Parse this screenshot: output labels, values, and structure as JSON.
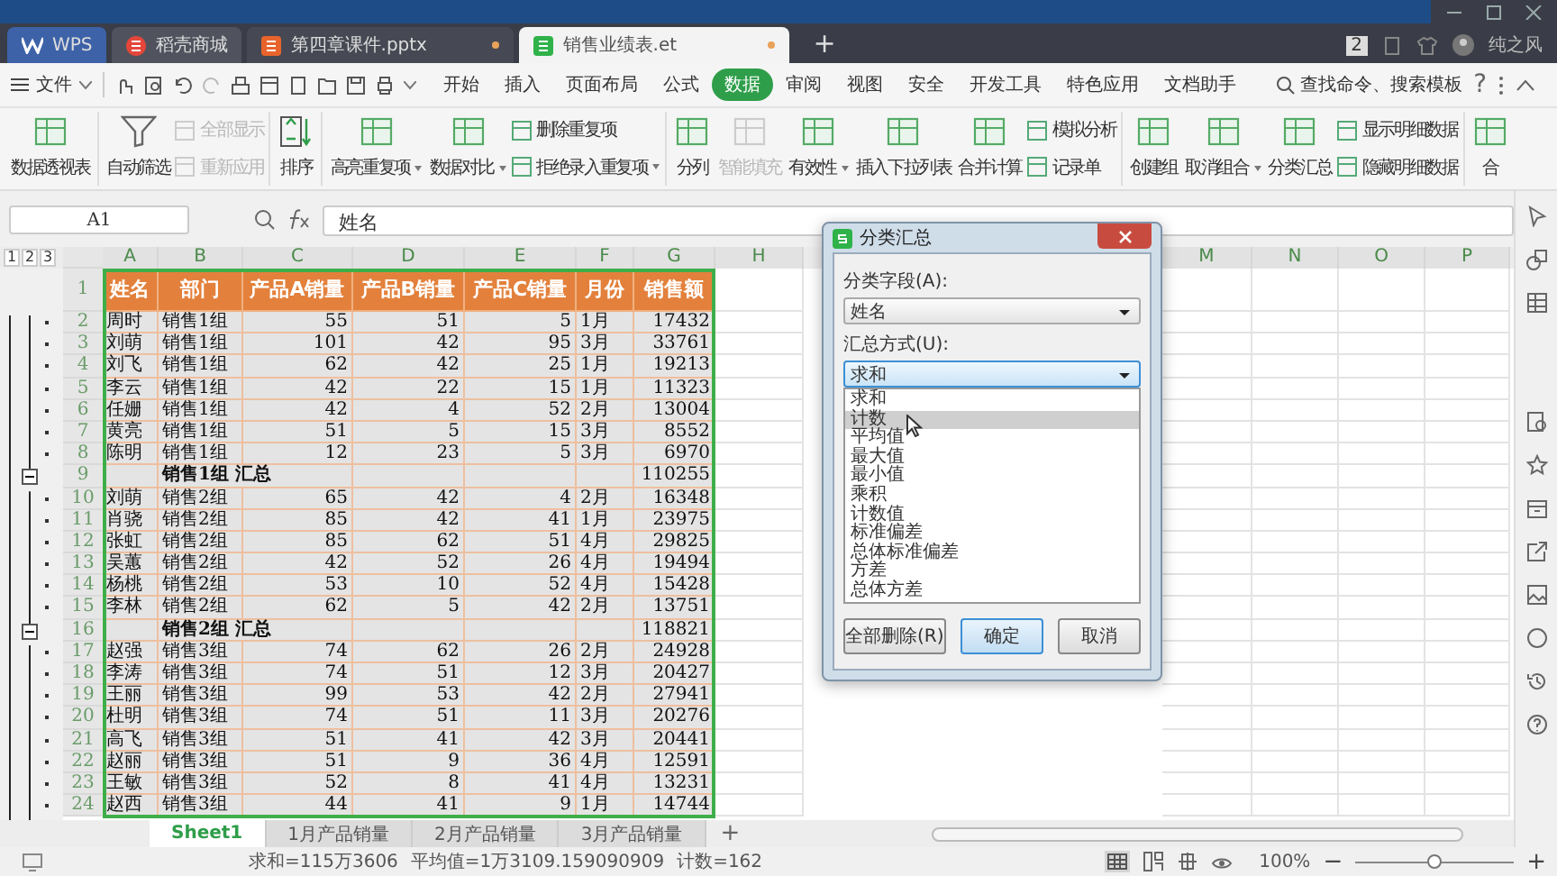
{
  "tabs": [
    {
      "label": "WPS",
      "kind": "home",
      "selected": false
    },
    {
      "label": "稻壳商城",
      "kind": "store",
      "selected": false
    },
    {
      "label": "第四章课件.pptx",
      "kind": "slides",
      "selected": false
    },
    {
      "label": "销售业绩表.et",
      "kind": "sheet",
      "selected": true
    }
  ],
  "new_tab": "+",
  "title_bar": {
    "badge": "2",
    "user": "纯之风"
  },
  "menu": {
    "file": "文件",
    "tabs": [
      {
        "label": "开始",
        "selected": false
      },
      {
        "label": "插入",
        "selected": false
      },
      {
        "label": "页面布局",
        "selected": false
      },
      {
        "label": "公式",
        "selected": false
      },
      {
        "label": "数据",
        "selected": true
      },
      {
        "label": "审阅",
        "selected": false
      },
      {
        "label": "视图",
        "selected": false
      },
      {
        "label": "安全",
        "selected": false
      },
      {
        "label": "开发工具",
        "selected": false
      },
      {
        "label": "特色应用",
        "selected": false
      },
      {
        "label": "文档助手",
        "selected": false
      }
    ],
    "search": "查找命令、搜索模板",
    "help": "?"
  },
  "ribbon": [
    {
      "items": [
        {
          "kind": "large",
          "label": "数据透视表",
          "dropdown": false,
          "disabled": false
        }
      ]
    },
    {
      "items": [
        {
          "kind": "large",
          "label": "自动筛选",
          "dropdown": false,
          "disabled": false
        },
        {
          "kind": "pair",
          "items": [
            {
              "label": "全部显示",
              "dropdown": false,
              "disabled": true
            },
            {
              "label": "重新应用",
              "dropdown": false,
              "disabled": true
            }
          ]
        }
      ]
    },
    {
      "items": [
        {
          "kind": "large",
          "label": "排序",
          "dropdown": false,
          "disabled": false
        }
      ]
    },
    {
      "items": [
        {
          "kind": "large",
          "label": "高亮重复项",
          "dropdown": true,
          "disabled": false
        },
        {
          "kind": "large",
          "label": "数据对比",
          "dropdown": true,
          "disabled": false
        },
        {
          "kind": "pair",
          "items": [
            {
              "label": "删除重复项",
              "dropdown": false,
              "disabled": false
            },
            {
              "label": "拒绝录入重复项",
              "dropdown": true,
              "disabled": false
            }
          ]
        }
      ]
    },
    {
      "items": [
        {
          "kind": "large",
          "label": "分列",
          "dropdown": false,
          "disabled": false
        },
        {
          "kind": "large",
          "label": "智能填充",
          "dropdown": false,
          "disabled": true
        },
        {
          "kind": "large",
          "label": "有效性",
          "dropdown": true,
          "disabled": false
        },
        {
          "kind": "large",
          "label": "插入下拉列表",
          "dropdown": false,
          "disabled": false
        },
        {
          "kind": "large",
          "label": "合并计算",
          "dropdown": false,
          "disabled": false
        },
        {
          "kind": "pair",
          "items": [
            {
              "label": "模拟分析",
              "dropdown": false,
              "disabled": false
            },
            {
              "label": "记录单",
              "dropdown": false,
              "disabled": false
            }
          ]
        }
      ]
    },
    {
      "items": [
        {
          "kind": "large",
          "label": "创建组",
          "dropdown": false,
          "disabled": false
        },
        {
          "kind": "large",
          "label": "取消组合",
          "dropdown": true,
          "disabled": false
        },
        {
          "kind": "large",
          "label": "分类汇总",
          "dropdown": false,
          "disabled": false
        },
        {
          "kind": "pair",
          "items": [
            {
              "label": "显示明细数据",
              "dropdown": false,
              "disabled": false
            },
            {
              "label": "隐藏明细数据",
              "dropdown": false,
              "disabled": false
            }
          ]
        }
      ]
    },
    {
      "items": [
        {
          "kind": "large",
          "label": "合",
          "dropdown": false,
          "disabled": false
        }
      ]
    }
  ],
  "formula_bar": {
    "name_box": "A1",
    "formula": "姓名"
  },
  "outline_levels": [
    "1",
    "2",
    "3"
  ],
  "columns": [
    "A",
    "B",
    "C",
    "D",
    "E",
    "F",
    "G",
    "H",
    "M",
    "N",
    "O",
    "P"
  ],
  "rows": [
    {
      "num": "1",
      "kind": "header",
      "cells": [
        "姓名",
        "部门",
        "产品A销量",
        "产品B销量",
        "产品C销量",
        "月份",
        "销售额"
      ]
    },
    {
      "num": "2",
      "kind": "data",
      "cells": [
        "周时",
        "销售1组",
        "55",
        "51",
        "5",
        "1月",
        "17432"
      ]
    },
    {
      "num": "3",
      "kind": "data",
      "cells": [
        "刘萌",
        "销售1组",
        "101",
        "42",
        "95",
        "3月",
        "33761"
      ]
    },
    {
      "num": "4",
      "kind": "data",
      "cells": [
        "刘飞",
        "销售1组",
        "62",
        "42",
        "25",
        "1月",
        "19213"
      ]
    },
    {
      "num": "5",
      "kind": "data",
      "cells": [
        "李云",
        "销售1组",
        "42",
        "22",
        "15",
        "1月",
        "11323"
      ]
    },
    {
      "num": "6",
      "kind": "data",
      "cells": [
        "任姗",
        "销售1组",
        "42",
        "4",
        "52",
        "2月",
        "13004"
      ]
    },
    {
      "num": "7",
      "kind": "data",
      "cells": [
        "黄亮",
        "销售1组",
        "51",
        "5",
        "15",
        "3月",
        "8552"
      ]
    },
    {
      "num": "8",
      "kind": "data",
      "cells": [
        "陈明",
        "销售1组",
        "12",
        "23",
        "5",
        "3月",
        "6970"
      ]
    },
    {
      "num": "9",
      "kind": "subtotal",
      "label": "销售1组 汇总",
      "total": "110255"
    },
    {
      "num": "10",
      "kind": "data",
      "cells": [
        "刘萌",
        "销售2组",
        "65",
        "42",
        "4",
        "2月",
        "16348"
      ]
    },
    {
      "num": "11",
      "kind": "data",
      "cells": [
        "肖骁",
        "销售2组",
        "85",
        "42",
        "41",
        "1月",
        "23975"
      ]
    },
    {
      "num": "12",
      "kind": "data",
      "cells": [
        "张虹",
        "销售2组",
        "85",
        "62",
        "51",
        "4月",
        "29825"
      ]
    },
    {
      "num": "13",
      "kind": "data",
      "cells": [
        "吴蕙",
        "销售2组",
        "42",
        "52",
        "26",
        "4月",
        "19494"
      ]
    },
    {
      "num": "14",
      "kind": "data",
      "cells": [
        "杨桃",
        "销售2组",
        "53",
        "10",
        "52",
        "4月",
        "15428"
      ]
    },
    {
      "num": "15",
      "kind": "data",
      "cells": [
        "李林",
        "销售2组",
        "62",
        "5",
        "42",
        "2月",
        "13751"
      ]
    },
    {
      "num": "16",
      "kind": "subtotal",
      "label": "销售2组 汇总",
      "total": "118821"
    },
    {
      "num": "17",
      "kind": "data",
      "cells": [
        "赵强",
        "销售3组",
        "74",
        "62",
        "26",
        "2月",
        "24928"
      ]
    },
    {
      "num": "18",
      "kind": "data",
      "cells": [
        "李涛",
        "销售3组",
        "74",
        "51",
        "12",
        "3月",
        "20427"
      ]
    },
    {
      "num": "19",
      "kind": "data",
      "cells": [
        "王丽",
        "销售3组",
        "99",
        "53",
        "42",
        "2月",
        "27941"
      ]
    },
    {
      "num": "20",
      "kind": "data",
      "cells": [
        "杜明",
        "销售3组",
        "74",
        "51",
        "11",
        "3月",
        "20276"
      ]
    },
    {
      "num": "21",
      "kind": "data",
      "cells": [
        "高飞",
        "销售3组",
        "51",
        "41",
        "42",
        "3月",
        "20441"
      ]
    },
    {
      "num": "22",
      "kind": "data",
      "cells": [
        "赵丽",
        "销售3组",
        "51",
        "9",
        "36",
        "4月",
        "12591"
      ]
    },
    {
      "num": "23",
      "kind": "data",
      "cells": [
        "王敏",
        "销售3组",
        "52",
        "8",
        "41",
        "4月",
        "13231"
      ]
    },
    {
      "num": "24",
      "kind": "data",
      "cells": [
        "赵西",
        "销售3组",
        "44",
        "41",
        "9",
        "1月",
        "14744"
      ]
    }
  ],
  "dialog": {
    "title": "分类汇总",
    "field_label": "分类字段(A):",
    "field_value": "姓名",
    "method_label": "汇总方式(U):",
    "method_value": "求和",
    "options": [
      {
        "label": "求和",
        "selected": false
      },
      {
        "label": "计数",
        "selected": true
      },
      {
        "label": "平均值",
        "selected": false
      },
      {
        "label": "最大值",
        "selected": false
      },
      {
        "label": "最小值",
        "selected": false
      },
      {
        "label": "乘积",
        "selected": false
      },
      {
        "label": "计数值",
        "selected": false
      },
      {
        "label": "标准偏差",
        "selected": false
      },
      {
        "label": "总体标准偏差",
        "selected": false
      },
      {
        "label": "方差",
        "selected": false
      },
      {
        "label": "总体方差",
        "selected": false
      }
    ],
    "buttons": [
      {
        "label": "全部删除(R)",
        "kind": "normal"
      },
      {
        "label": "确定",
        "kind": "default"
      },
      {
        "label": "取消",
        "kind": "normal"
      }
    ]
  },
  "sheet_tabs": [
    {
      "label": "Sheet1",
      "selected": true
    },
    {
      "label": "1月产品销量",
      "selected": false
    },
    {
      "label": "2月产品销量",
      "selected": false
    },
    {
      "label": "3月产品销量",
      "selected": false
    }
  ],
  "add_sheet": "+",
  "status_bar": {
    "sum": "求和=115万3606",
    "average": "平均值=1万3109.159090909",
    "count": "计数=162",
    "zoom": "100%",
    "zoom_out": "−",
    "zoom_in": "+",
    "zoom_slider": {
      "level": 0.5
    }
  }
}
